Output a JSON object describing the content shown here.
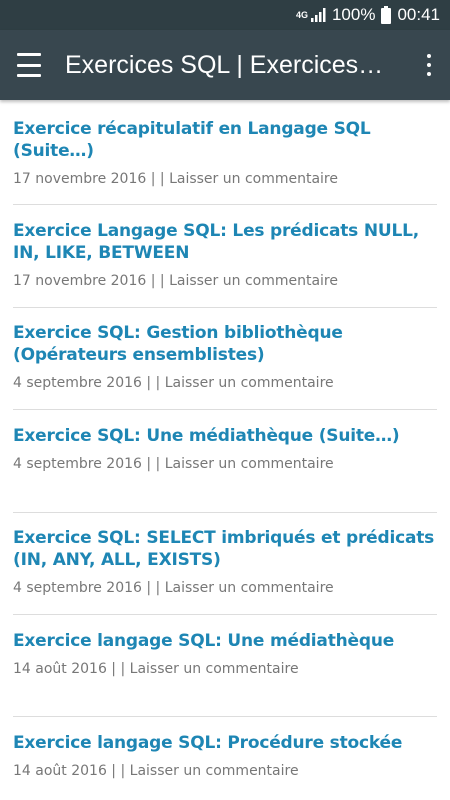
{
  "status_bar": {
    "network": "4G",
    "battery": "100%",
    "time": "00:41"
  },
  "app_bar": {
    "title": "Exercices SQL | Exercices c..."
  },
  "posts": [
    {
      "title": "Exercice récapitulatif en Langage SQL (Suite…)",
      "date": "17 novembre 2016",
      "sep": " | | ",
      "comment": "Laisser un commentaire"
    },
    {
      "title": "Exercice Langage SQL: Les prédicats NULL, IN, LIKE, BETWEEN",
      "date": "17 novembre 2016",
      "sep": " | | ",
      "comment": "Laisser un commentaire"
    },
    {
      "title": "Exercice SQL: Gestion bibliothèque (Opérateurs ensemblistes)",
      "date": "4 septembre 2016",
      "sep": " | | ",
      "comment": "Laisser un commentaire"
    },
    {
      "title": "Exercice SQL: Une médiathèque (Suite…)",
      "date": "4 septembre 2016",
      "sep": " | | ",
      "comment": "Laisser un commentaire"
    },
    {
      "title": "Exercice SQL: SELECT imbriqués et prédicats (IN, ANY, ALL, EXISTS)",
      "date": "4 septembre 2016",
      "sep": " | | ",
      "comment": "Laisser un commentaire"
    },
    {
      "title": "Exercice langage SQL: Une médiathèque",
      "date": "14 août 2016",
      "sep": " | | ",
      "comment": "Laisser un commentaire"
    },
    {
      "title": "Exercice langage SQL: Procédure stockée",
      "date": "14 août 2016",
      "sep": " | | ",
      "comment": "Laisser un commentaire"
    }
  ]
}
